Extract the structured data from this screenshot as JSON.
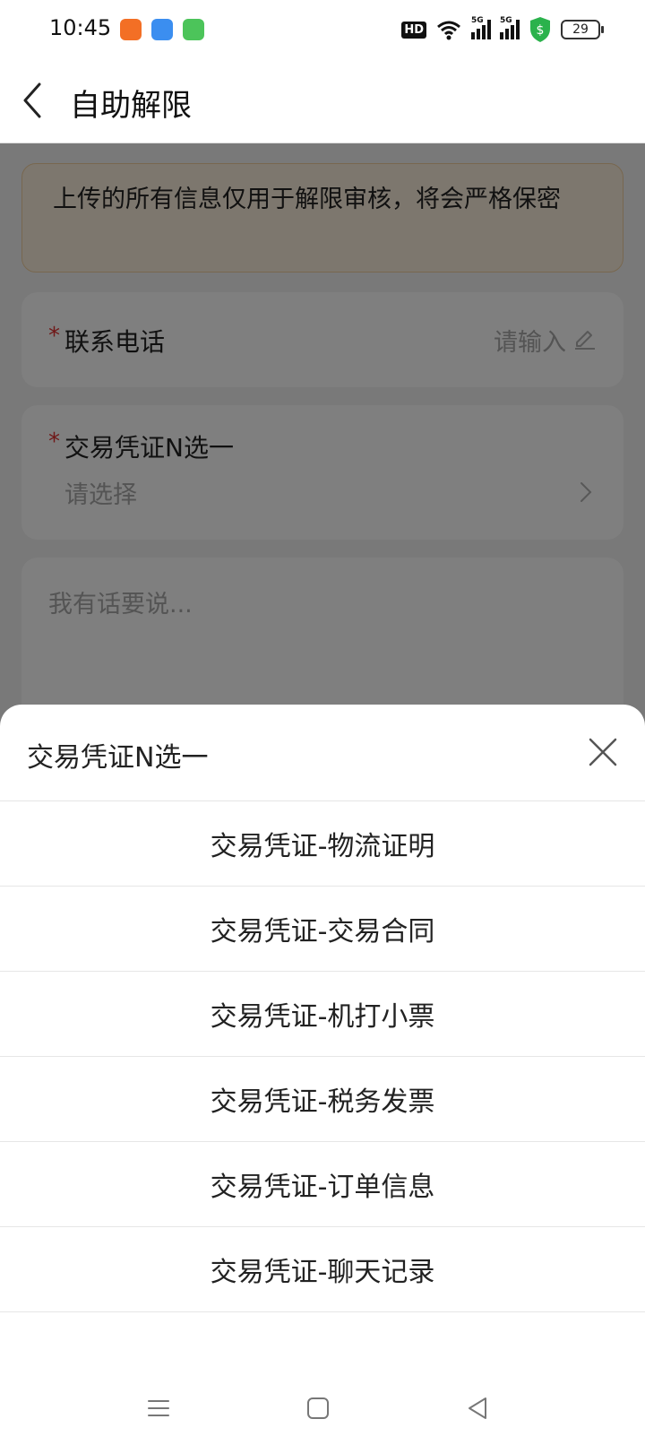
{
  "status_bar": {
    "time": "10:45",
    "apps": [
      "app-icon-orange",
      "app-icon-blue",
      "app-icon-green"
    ],
    "hd": "HD",
    "network": [
      "5G",
      "5G"
    ],
    "battery": "29",
    "colors": {
      "orange": "#f36f25",
      "blue": "#3b8ef0",
      "green": "#4cc45a",
      "shield": "#2bb24c"
    }
  },
  "header": {
    "title": "自助解限"
  },
  "notice": {
    "text": "上传的所有信息仅用于解限审核，将会严格保密"
  },
  "form": {
    "phone": {
      "required_mark": "*",
      "label": "联系电话",
      "placeholder": "请输入"
    },
    "voucher": {
      "required_mark": "*",
      "label": "交易凭证N选一",
      "placeholder": "请选择"
    },
    "remark": {
      "placeholder": "我有话要说..."
    }
  },
  "sheet": {
    "title": "交易凭证N选一",
    "options": [
      "交易凭证-物流证明",
      "交易凭证-交易合同",
      "交易凭证-机打小票",
      "交易凭证-税务发票",
      "交易凭证-订单信息",
      "交易凭证-聊天记录"
    ]
  },
  "navbar": {
    "buttons": [
      "menu-icon",
      "home-icon",
      "back-triangle-icon"
    ]
  }
}
